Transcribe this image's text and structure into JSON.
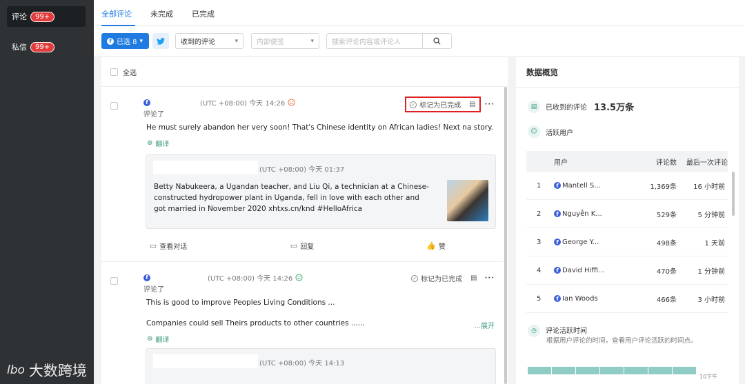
{
  "sidebar": {
    "items": [
      {
        "label": "评论",
        "badge": "99+"
      },
      {
        "label": "私信",
        "badge": "99+"
      }
    ],
    "watermark": "大数跨境",
    "watermark_logo": "lbo"
  },
  "tabs": {
    "items": [
      {
        "label": "全部评论",
        "active": true
      },
      {
        "label": "未完成"
      },
      {
        "label": "已完成"
      }
    ]
  },
  "filters": {
    "selected_label": "已选 8",
    "received_label": "收到的评论",
    "internal_label": "内部便签",
    "search_placeholder": "搜索评论内容或评论人"
  },
  "comment_list": {
    "select_all": "全选",
    "comments": [
      {
        "time": "(UTC +08:00)  今天 14:26",
        "verb": "评论了",
        "text": "He must surely abandon her very soon! That's Chinese identity on African ladies! Next na story.",
        "translate": "翻译",
        "mark_done": "标记为已完成",
        "sentiment": "negative",
        "quote": {
          "time": "(UTC +08:00)  今天 01:37",
          "text": "Betty Nabukeera, a Ugandan teacher, and Liu Qi, a technician at a Chinese-constructed hydropower plant in Uganda, fell in love with each other and got married in November 2020 xhtxs.cn/knd #HelloAfrica"
        },
        "actions": {
          "view": "查看对话",
          "reply": "回复",
          "like": "赞"
        }
      },
      {
        "time": "(UTC +08:00)  今天 14:26",
        "verb": "评论了",
        "text": "This is good to improve Peoples Living Conditions ...",
        "text2": "Companies could sell Theirs products to other countries ......",
        "expand": "...展开",
        "translate": "翻译",
        "mark_done": "标记为已完成",
        "sentiment": "positive",
        "quote": {
          "time": "(UTC +08:00)  今天 14:13"
        }
      }
    ]
  },
  "overview": {
    "title": "数据概览",
    "received_label": "已收到的评论",
    "received_value": "13.5万条",
    "active_users_label": "活跃用户",
    "table": {
      "headers": [
        "用户",
        "评论数",
        "最后一次评论"
      ],
      "rows": [
        {
          "idx": "1",
          "user": "Mantell S...",
          "count": "1,369条",
          "last": "16 小时前"
        },
        {
          "idx": "2",
          "user": "Nguyễn K...",
          "count": "529条",
          "last": "5 分钟前"
        },
        {
          "idx": "3",
          "user": "George Y...",
          "count": "498条",
          "last": "1 天前"
        },
        {
          "idx": "4",
          "user": "David Hiffi...",
          "count": "470条",
          "last": "1 分钟前"
        },
        {
          "idx": "5",
          "user": "Ian Woods",
          "count": "466条",
          "last": "3 小时前"
        }
      ]
    },
    "activity_title": "评论活跃时间",
    "activity_sub": "根据用户评论的时间，查看用户评论活跃的时间点。",
    "heat_label": "10下午"
  },
  "colors": {
    "accent": "#1f7be0",
    "sidebar_bg": "#2e3234",
    "badge": "#e23b3b",
    "highlight": "#e02020",
    "teal": "#3a9a80"
  }
}
